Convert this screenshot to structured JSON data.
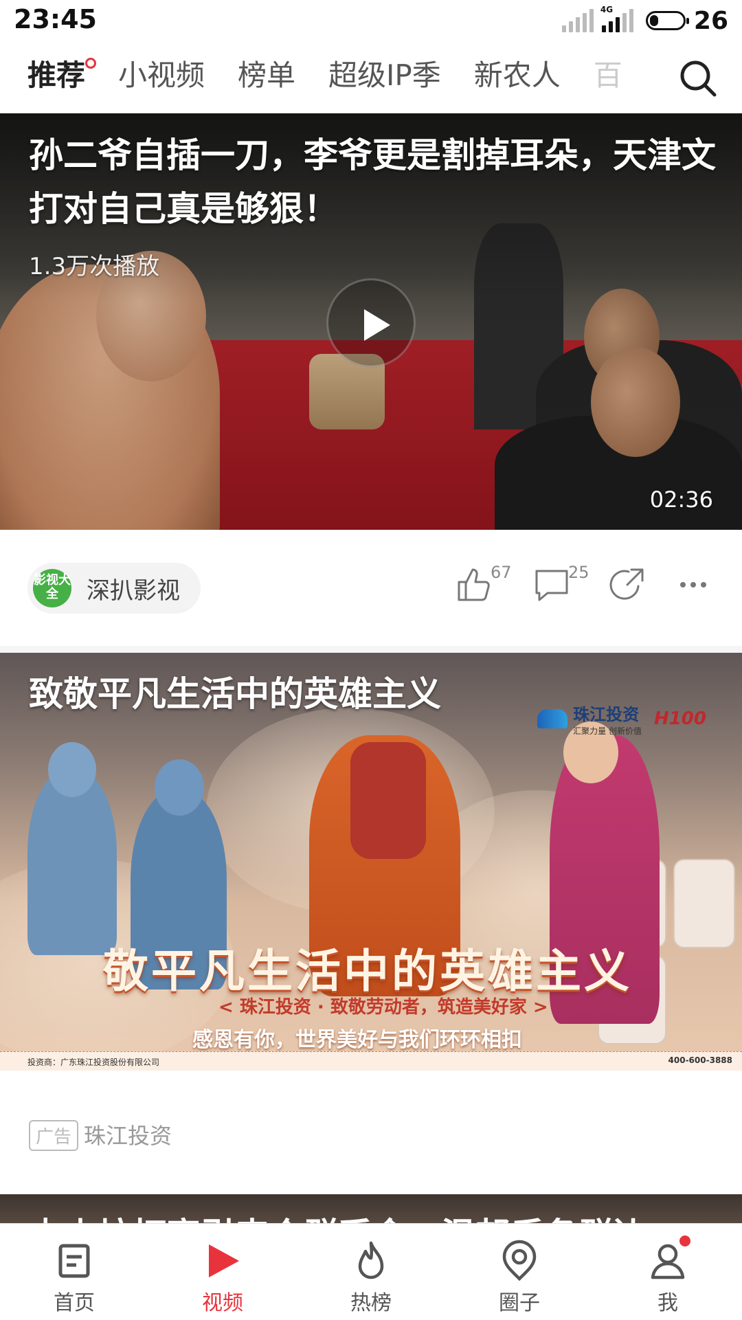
{
  "status": {
    "time": "23:45",
    "network": "4G",
    "battery": "26",
    "battery_level": 0.26
  },
  "tabs": [
    {
      "label": "推荐",
      "active": true,
      "badge": "dot"
    },
    {
      "label": "小视频"
    },
    {
      "label": "榜单"
    },
    {
      "label": "超级IP季"
    },
    {
      "label": "新农人"
    },
    {
      "label": "百"
    }
  ],
  "search": {
    "icon": "search-icon"
  },
  "video1": {
    "title": "孙二爷自插一刀，李爷更是割掉耳朵，天津文打对自己真是够狠！",
    "plays": "1.3万次播放",
    "duration": "02:36",
    "author": {
      "name": "深扒影视",
      "avatar_text": "影视大全",
      "avatar_color": "#46b046"
    },
    "likes": "67",
    "comments": "25",
    "icons": [
      "thumbs-up-icon",
      "comment-icon",
      "share-icon",
      "more-icon"
    ]
  },
  "ad": {
    "title": "致敬平凡生活中的英雄主义",
    "logo_name": "珠江投资",
    "logo_slogan": "汇聚力量 创新价值",
    "logo_h100": "H100",
    "big_text": "敬平凡生活中的英雄主义",
    "sub1": "< 珠江投资 · 致敬劳动者，筑造美好家 >",
    "sub2": "感恩有你，世界美好与我们环环相扣",
    "footer_left": "投资商：广东珠江投资股份有限公司",
    "footer_right": "400-600-3888",
    "badge": "广告",
    "brand": "珠江投资"
  },
  "next_card": {
    "title": "占山坊打官引来众群采食，温邦后备群边"
  },
  "bottom_nav": [
    {
      "label": "首页",
      "icon": "home-icon"
    },
    {
      "label": "视频",
      "icon": "video-play-icon",
      "active": true
    },
    {
      "label": "热榜",
      "icon": "flame-icon"
    },
    {
      "label": "圈子",
      "icon": "circle-icon"
    },
    {
      "label": "我",
      "icon": "user-icon",
      "badge": "dot"
    }
  ],
  "colors": {
    "accent": "#e8333d",
    "text": "#222222",
    "muted": "#999999"
  }
}
